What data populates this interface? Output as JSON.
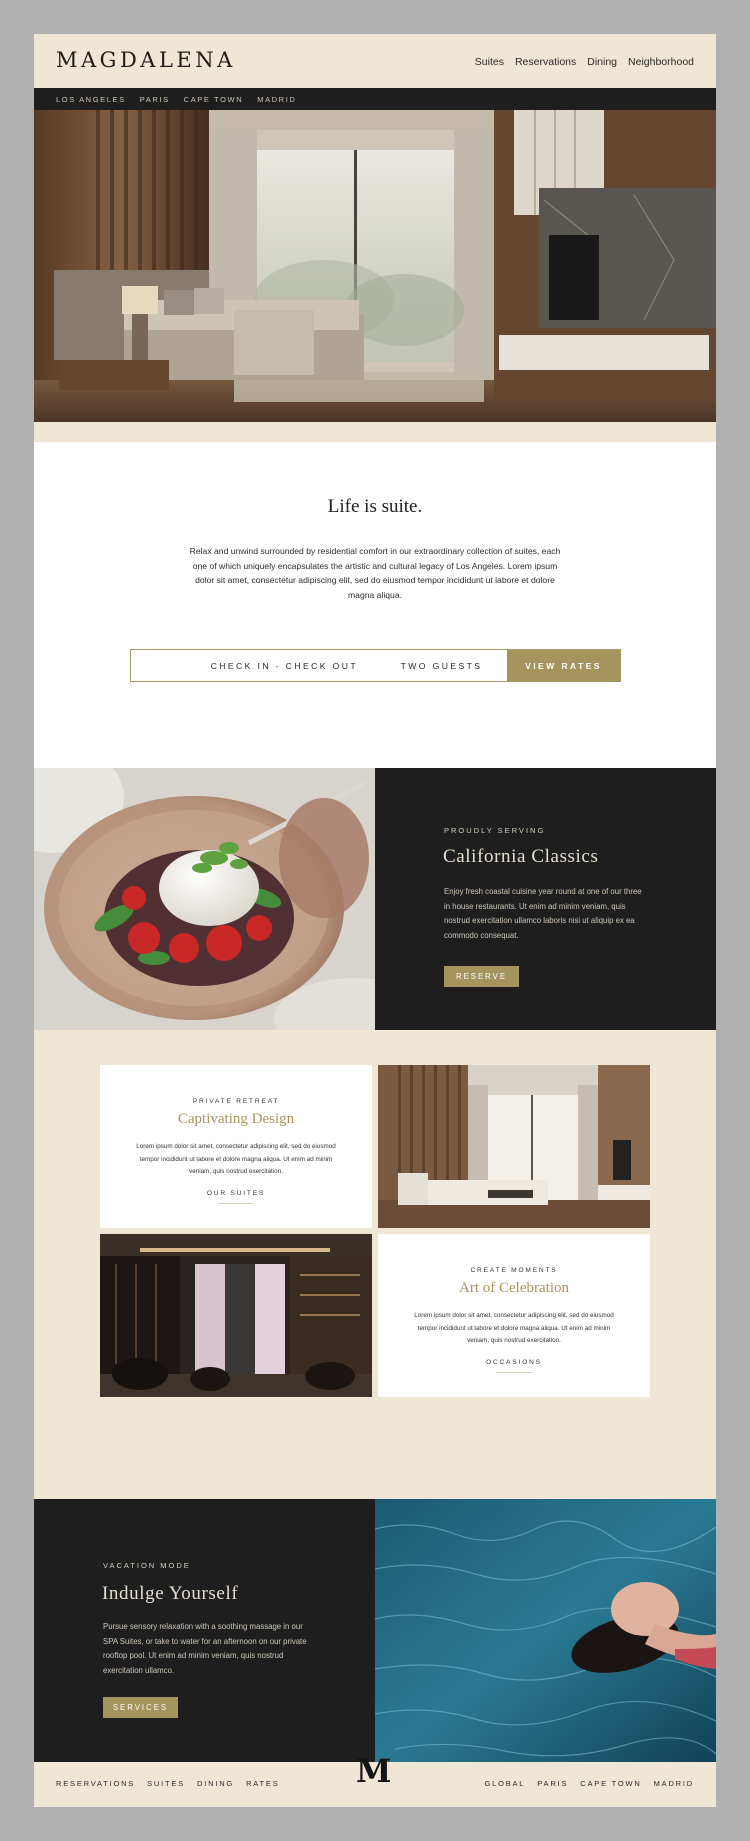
{
  "brand": {
    "name": "MAGDALENA",
    "monogram": "M"
  },
  "nav": {
    "main": [
      "Suites",
      "Reservations",
      "Dining",
      "Neighborhood"
    ],
    "cities": [
      "LOS ANGELES",
      "PARIS",
      "CAPE TOWN",
      "MADRID"
    ]
  },
  "intro": {
    "title": "Life is suite.",
    "body": "Relax and unwind surrounded by residential comfort in our extraordinary collection of suites, each one of which uniquely encapsulates the artistic and cultural legacy  of Los Angeles. Lorem ipsum dolor sit amet, consectetur adipiscing elit, sed do eiusmod tempor incididunt ut labore et dolore magna aliqua."
  },
  "booking": {
    "dates_label": "CHECK IN - CHECK OUT",
    "guests_label": "TWO GUESTS",
    "cta": "VIEW RATES"
  },
  "dining": {
    "eyebrow": "PROUDLY SERVING",
    "title": "California Classics",
    "body": "Enjoy fresh coastal cuisine year round at one of our three in house restaurants. Ut enim ad minim veniam, quis nostrud exercitation ullamco laboris nisi ut aliquip ex ea commodo consequat.",
    "cta": "RESERVE"
  },
  "design_card": {
    "eyebrow": "PRIVATE RETREAT",
    "title": "Captivating Design",
    "body": "Lorem ipsum dolor sit amet, consectetur adipiscing elit, sed do eiusmod tempor incididunt ut labore et dolore magna aliqua. Ut enim ad minim veniam, quis nostrud exercitation.",
    "link": "OUR SUITES"
  },
  "celebration_card": {
    "eyebrow": "CREATE MOMENTS",
    "title": "Art of Celebration",
    "body": "Lorem ipsum dolor sit amet, consectetur adipiscing elit, sed do eiusmod tempor incididunt ut labore et dolore magna aliqua. Ut enim ad minim veniam, quis nostrud exercitation.",
    "link": "OCCASIONS"
  },
  "spa": {
    "eyebrow": "VACATION MODE",
    "title": "Indulge Yourself",
    "body": "Pursue sensory relaxation with a soothing massage in our SPA Suites, or take to water for an afternoon on our private rooftop pool. Ut enim ad minim veniam, quis nostrud exercitation ullamco.",
    "cta": "SERVICES"
  },
  "footer": {
    "left": [
      "RESERVATIONS",
      "SUITES",
      "DINING",
      "RATES"
    ],
    "right": [
      "GLOBAL",
      "PARIS",
      "CAPE TOWN",
      "MADRID"
    ]
  },
  "colors": {
    "background": "#b1b1b1",
    "cream": "#efe6d5",
    "dark": "#1e1e1f",
    "gold": "#a6945f"
  }
}
